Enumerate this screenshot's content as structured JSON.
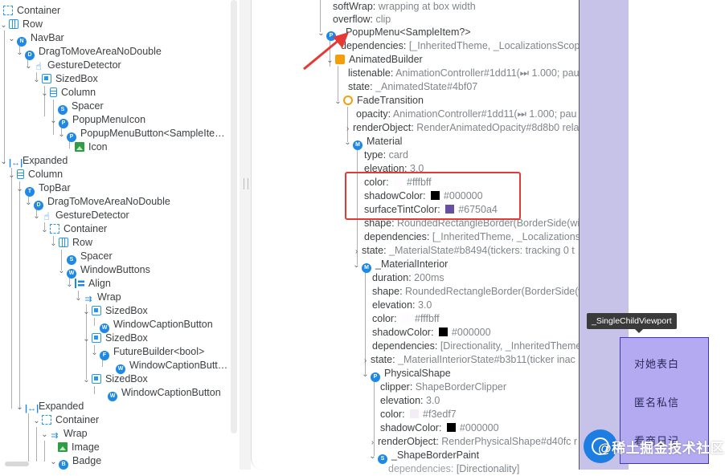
{
  "left_tree": [
    {
      "label": "Container",
      "icon": "container"
    },
    {
      "label": "Row",
      "icon": "row"
    },
    {
      "label": "NavBar",
      "icon": "circle",
      "glyph": "N"
    },
    {
      "label": "DragToMoveAreaNoDouble",
      "icon": "circle",
      "glyph": "D"
    },
    {
      "label": "GestureDetector",
      "icon": "gesture"
    },
    {
      "label": "SizedBox",
      "icon": "sized"
    },
    {
      "label": "Column",
      "icon": "column"
    },
    {
      "label": "Spacer",
      "icon": "circle",
      "glyph": "S"
    },
    {
      "label": "PopupMenuIcon",
      "icon": "circle",
      "glyph": "P"
    },
    {
      "label": "PopupMenuButton<SampleIte…",
      "icon": "circle",
      "glyph": "P"
    },
    {
      "label": "Icon",
      "icon": "image"
    },
    {
      "label": "Expanded",
      "icon": "expanded"
    },
    {
      "label": "Column",
      "icon": "column"
    },
    {
      "label": "TopBar",
      "icon": "circle",
      "glyph": "T"
    },
    {
      "label": "DragToMoveAreaNoDouble",
      "icon": "circle",
      "glyph": "D"
    },
    {
      "label": "GestureDetector",
      "icon": "gesture"
    },
    {
      "label": "Container",
      "icon": "container"
    },
    {
      "label": "Row",
      "icon": "row"
    },
    {
      "label": "Spacer",
      "icon": "circle",
      "glyph": "S"
    },
    {
      "label": "WindowButtons",
      "icon": "circle",
      "glyph": "W"
    },
    {
      "label": "Align",
      "icon": "align"
    },
    {
      "label": "Wrap",
      "icon": "wrap"
    },
    {
      "label": "SizedBox",
      "icon": "sized"
    },
    {
      "label": "WindowCaptionButton",
      "icon": "circle",
      "glyph": "W"
    },
    {
      "label": "SizedBox",
      "icon": "sized"
    },
    {
      "label": "FutureBuilder<bool>",
      "icon": "circle",
      "glyph": "F"
    },
    {
      "label": "WindowCaptionButt…",
      "icon": "circle",
      "glyph": "W"
    },
    {
      "label": "SizedBox",
      "icon": "sized"
    },
    {
      "label": "WindowCaptionButton",
      "icon": "circle",
      "glyph": "W"
    },
    {
      "label": "Expanded",
      "icon": "expanded"
    },
    {
      "label": "Container",
      "icon": "container"
    },
    {
      "label": "Wrap",
      "icon": "wrap"
    },
    {
      "label": "Image",
      "icon": "image"
    },
    {
      "label": "Badge",
      "icon": "circle",
      "glyph": "B"
    }
  ],
  "props": [
    {
      "key": "softWrap",
      "value": "wrapping at box width"
    },
    {
      "key": "overflow",
      "value": "clip"
    },
    {
      "key": "_PopupMenu<SampleItem?>",
      "value": ""
    },
    {
      "key": "dependencies",
      "value": "[_InheritedTheme, _LocalizationsScope"
    },
    {
      "key": "AnimatedBuilder",
      "value": ""
    },
    {
      "key": "listenable",
      "value": "AnimationController#1dd11(⏭ 1.000; pau"
    },
    {
      "key": "state",
      "value": "_AnimatedState#4bf07"
    },
    {
      "key": "FadeTransition",
      "value": ""
    },
    {
      "key": "opacity",
      "value": "AnimationController#1dd11(⏭ 1.000; pau"
    },
    {
      "key": "renderObject",
      "value": "RenderAnimatedOpacity#8d8b0 rela"
    },
    {
      "key": "Material",
      "value": ""
    },
    {
      "key": "type",
      "value": "card"
    },
    {
      "key": "elevation",
      "value": "3.0"
    },
    {
      "key": "color",
      "value": "#fffbff"
    },
    {
      "key": "shadowColor",
      "value": "#000000"
    },
    {
      "key": "surfaceTintColor",
      "value": "#6750a4"
    },
    {
      "key": "shape",
      "value": "RoundedRectangleBorder(BorderSide(wi"
    },
    {
      "key": "dependencies",
      "value": "[_InheritedTheme, _Localizations"
    },
    {
      "key": "state",
      "value": "_MaterialState#b8494(tickers: tracking 0 t"
    },
    {
      "key": "_MaterialInterior",
      "value": ""
    },
    {
      "key": "duration",
      "value": "200ms"
    },
    {
      "key": "shape",
      "value": "RoundedRectangleBorder(BorderSide(w"
    },
    {
      "key": "elevation",
      "value": "3.0"
    },
    {
      "key": "color",
      "value": "#fffbff"
    },
    {
      "key": "shadowColor",
      "value": "#000000"
    },
    {
      "key": "dependencies",
      "value": "[Directionality, _InheritedTheme"
    },
    {
      "key": "state",
      "value": "_MaterialInteriorState#b3b11(ticker inac"
    },
    {
      "key": "PhysicalShape",
      "value": ""
    },
    {
      "key": "clipper",
      "value": "ShapeBorderClipper"
    },
    {
      "key": "elevation",
      "value": "3.0"
    },
    {
      "key": "color",
      "value": "#f3edf7"
    },
    {
      "key": "shadowColor",
      "value": "#000000"
    },
    {
      "key": "renderObject",
      "value": "RenderPhysicalShape#d40fc r"
    },
    {
      "key": "_ShapeBorderPaint",
      "value": ""
    },
    {
      "key": "dependencies",
      "value": "[Directionality]"
    }
  ],
  "colors": {
    "white": "#fffbff",
    "black": "#000000",
    "tint": "#6750a4",
    "surface": "#f3edf7",
    "highlight": "#e53935"
  },
  "tooltip": "_SingleChildViewport",
  "popup_menu": [
    "对她表白",
    "匿名私信",
    "看商日记"
  ],
  "watermark": "@稀土掘金技术社区"
}
